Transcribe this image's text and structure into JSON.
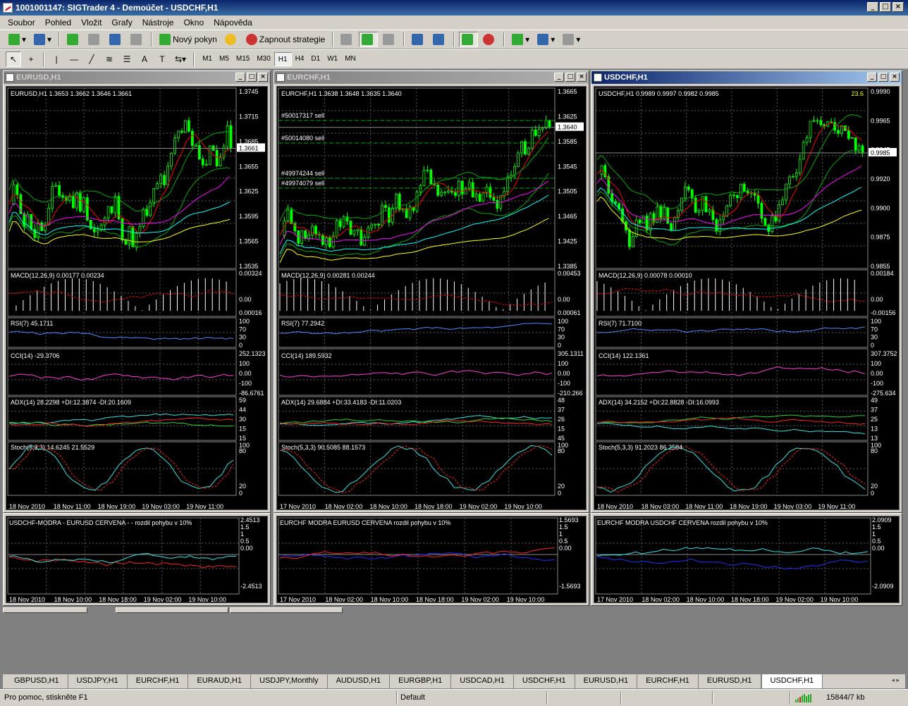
{
  "app": {
    "title": "1001001147: SIGTrader 4 - Demoúčet - USDCHF,H1"
  },
  "menu": [
    "Soubor",
    "Pohled",
    "Vložit",
    "Grafy",
    "Nástroje",
    "Okno",
    "Nápověda"
  ],
  "toolbar": {
    "new_order": "Nový pokyn",
    "strategy": "Zapnout strategie"
  },
  "timeframes": [
    "M1",
    "M5",
    "M15",
    "M30",
    "H1",
    "H4",
    "D1",
    "W1",
    "MN"
  ],
  "selected_tf": "H1",
  "charts": [
    {
      "title": "EURUSD,H1",
      "active": false,
      "header": "EURUSD,H1  1.3653 1.3662 1.3646 1.3661",
      "price_labels": [
        "1.3745",
        "1.3715",
        "1.3685",
        "1.3655",
        "1.3625",
        "1.3595",
        "1.3565",
        "1.3535"
      ],
      "current_price": "1.3661",
      "macd": "MACD(12,26,9) 0.00177 0.00234",
      "macd_scale": [
        "0.00324",
        "0.00"
      ],
      "macd_low": "0.00016",
      "rsi": "RSI(7) 45.1711",
      "rsi_scale": [
        "100",
        "70",
        "30",
        "0"
      ],
      "cci": "CCI(14) -29.3706",
      "cci_scale": [
        "252.1323",
        "100",
        "0.00",
        "-100",
        "-86.6761"
      ],
      "adx": "ADX(14) 28.2298 +DI:12.3874 -DI:20.1609",
      "adx_scale": [
        "59",
        "44",
        "30",
        "15",
        "15"
      ],
      "stoch": "Stoch(5,3,3) 14.6245 21.5529",
      "stoch_scale": [
        "100",
        "80",
        "20",
        "0"
      ],
      "dates": [
        "18 Nov 2010",
        "18 Nov 11:00",
        "18 Nov 19:00",
        "19 Nov 03:00",
        "19 Nov 11:00"
      ],
      "orders": []
    },
    {
      "title": "EURCHF,H1",
      "active": false,
      "header": "EURCHF,H1  1.3638 1.3648 1.3635 1.3640",
      "price_labels": [
        "1.3665",
        "1.3625",
        "1.3585",
        "1.3545",
        "1.3505",
        "1.3465",
        "1.3425",
        "1.3385"
      ],
      "current_price": "1.3640",
      "macd": "MACD(12,26,9) 0.00281 0.00244",
      "macd_scale": [
        "0.00453",
        "0.00"
      ],
      "macd_low": "0.00061",
      "rsi": "RSI(7) 77.2942",
      "rsi_scale": [
        "100",
        "70",
        "30",
        "0"
      ],
      "cci": "CCI(14) 189.5932",
      "cci_scale": [
        "305.1311",
        "100",
        "0.00",
        "-100",
        "-210.266"
      ],
      "adx": "ADX(14) 29.6884 +DI:33.4183 -DI:11.0203",
      "adx_scale": [
        "48",
        "37",
        "26",
        "15",
        "45"
      ],
      "stoch": "Stoch(5,3,3) 90.5085 88.1573",
      "stoch_scale": [
        "100",
        "80",
        "20",
        "0"
      ],
      "dates": [
        "17 Nov 2010",
        "18 Nov 02:00",
        "18 Nov 10:00",
        "18 Nov 18:00",
        "19 Nov 02:00",
        "19 Nov 10:00"
      ],
      "orders": [
        "#50017317 sell",
        "#50014080 sell",
        "#49974244 sell",
        "#49974079 sell"
      ]
    },
    {
      "title": "USDCHF,H1",
      "active": true,
      "header": "USDCHF,H1  0.9989 0.9997 0.9982 0.9985",
      "price_labels": [
        "0.9990",
        "0.9965",
        "0.9945",
        "0.9920",
        "0.9900",
        "0.9875",
        "0.9855"
      ],
      "current_price": "0.9985",
      "corner_value": "23.6",
      "macd": "MACD(12,26,9) 0.00078 0.00010",
      "macd_scale": [
        "0.00184",
        "0.00"
      ],
      "macd_low": "-0.00156",
      "rsi": "RSI(7) 71.7100",
      "rsi_scale": [
        "100",
        "70",
        "30",
        "0"
      ],
      "cci": "CCI(14) 122.1361",
      "cci_scale": [
        "307.3752",
        "100",
        "0.00",
        "-100",
        "-275.634"
      ],
      "adx": "ADX(14) 34.2152 +DI:22.8828 -DI:16.0993",
      "adx_scale": [
        "49",
        "37",
        "25",
        "13",
        "13"
      ],
      "stoch": "Stoch(5,3,3) 91.2023 86.2584",
      "stoch_scale": [
        "100",
        "80",
        "20",
        "0"
      ],
      "dates": [
        "18 Nov 2010",
        "18 Nov 03:00",
        "18 Nov 11:00",
        "18 Nov 19:00",
        "19 Nov 03:00",
        "19 Nov 11:00"
      ],
      "orders": []
    }
  ],
  "compare": [
    {
      "label": "USDCHF-MODRA - EURUSD CERVENA - - rozdil pohybu v 10%",
      "scale": [
        "2.4513",
        "1.5",
        "1",
        "0.5",
        "0.00"
      ],
      "low": "-2.4513",
      "dates": [
        "18 Nov 2010",
        "18 Nov 10:00",
        "18 Nov 18:00",
        "19 Nov 02:00",
        "19 Nov 10:00"
      ]
    },
    {
      "label": "EURCHF MODRA   EURUSD CERVENA     rozdil pohybu v 10%",
      "scale": [
        "1.5693",
        "1.5",
        "1",
        "0.5",
        "0.00"
      ],
      "low": "-1.5693",
      "dates": [
        "17 Nov 2010",
        "18 Nov 02:00",
        "18 Nov 10:00",
        "18 Nov 18:00",
        "19 Nov 02:00",
        "19 Nov 10:00"
      ]
    },
    {
      "label": "EURCHF MODRA   USDCHF CERVENA     rozdil pohybu v 10%",
      "scale": [
        "2.0909",
        "1.5",
        "1",
        "0.5",
        "0.00"
      ],
      "low": "-2.0909",
      "dates": [
        "17 Nov 2010",
        "18 Nov 02:00",
        "18 Nov 10:00",
        "18 Nov 18:00",
        "19 Nov 02:00",
        "19 Nov 10:00"
      ]
    }
  ],
  "tabs": [
    "GBPUSD,H1",
    "USDJPY,H1",
    "EURCHF,H1",
    "EURAUD,H1",
    "USDJPY,Monthly",
    "AUDUSD,H1",
    "EURGBP,H1",
    "USDCAD,H1",
    "USDCHF,H1",
    "EURUSD,H1",
    "EURCHF,H1",
    "EURUSD,H1",
    "USDCHF,H1"
  ],
  "active_tab": 12,
  "status": {
    "help": "Pro pomoc, stiskněte F1",
    "profile": "Default",
    "traffic": "15844/7 kb"
  },
  "colors": {
    "bull": "#00ff00",
    "bear": "#ffffff",
    "ma_red": "#ff0000",
    "ma_magenta": "#ff00ff",
    "ma_cyan": "#00ffff",
    "ma_yellow": "#ffff00",
    "bands": "#00aa00",
    "text": "#ffffff",
    "grid": "#5a5a5a"
  }
}
